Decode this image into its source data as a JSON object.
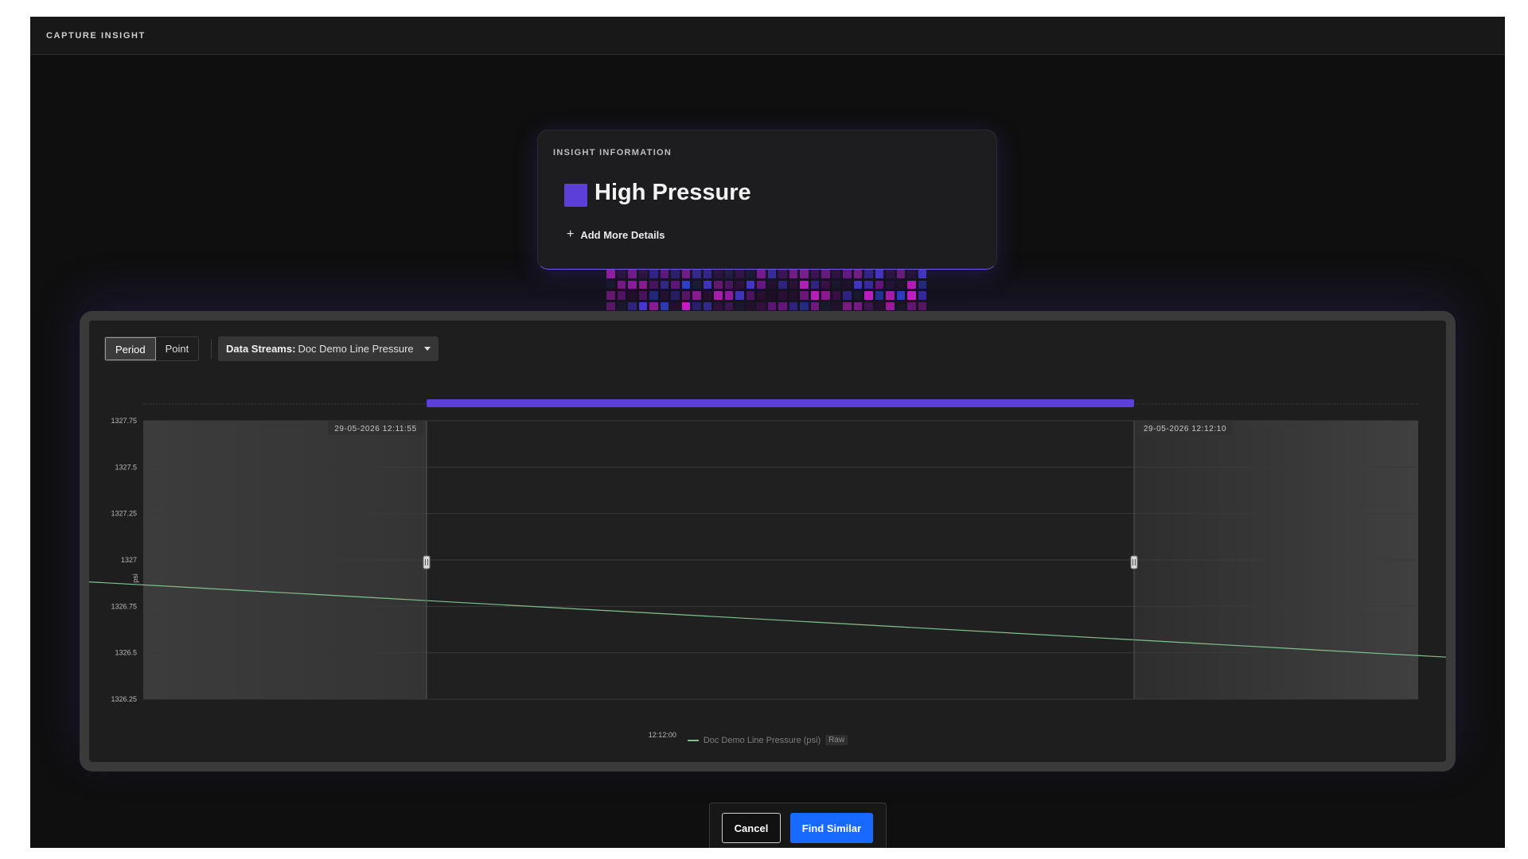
{
  "header": {
    "title": "CAPTURE INSIGHT"
  },
  "insight": {
    "heading": "INSIGHT INFORMATION",
    "name": "High Pressure",
    "swatch_color": "#5b3fd8",
    "add_details_label": "Add More Details",
    "add_icon": "plus-icon"
  },
  "toolbar": {
    "modes": [
      {
        "label": "Period",
        "active": true
      },
      {
        "label": "Point",
        "active": false
      }
    ],
    "stream_key": "Data Streams:",
    "stream_value": "Doc Demo Line Pressure",
    "stream_icon": "chevron-down-icon"
  },
  "chart_data": {
    "type": "line",
    "ylabel": "psi",
    "ylim": [
      1326.25,
      1327.75
    ],
    "y_ticks": [
      "1327.75",
      "1327.5",
      "1327.25",
      "1327",
      "1326.75",
      "1326.5",
      "1326.25"
    ],
    "x_tick_labels": [
      "12:12:00"
    ],
    "grid": true,
    "series": [
      {
        "name": "Doc Demo Line Pressure (psi)",
        "badge": "Raw",
        "color": "#7fc28f",
        "points": [
          {
            "x": "12:11:43",
            "y": 1326.95
          },
          {
            "x": "12:12:27",
            "y": 1326.33
          },
          {
            "x": "12:12:31",
            "y": 1326.44
          }
        ]
      }
    ],
    "selection": {
      "start_label": "29-05-2026 12:11:55",
      "end_label": "29-05-2026 12:12:10",
      "color": "#5b3fd8"
    }
  },
  "actions": {
    "cancel_label": "Cancel",
    "find_label": "Find Similar",
    "find_color": "#1769ff"
  }
}
